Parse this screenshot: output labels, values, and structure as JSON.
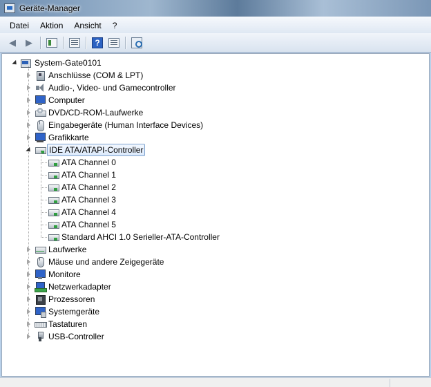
{
  "window": {
    "title": "Geräte-Manager"
  },
  "menu": [
    "Datei",
    "Aktion",
    "Ansicht",
    "?"
  ],
  "toolbar": {
    "buttons": [
      "back-icon",
      "forward-icon",
      "show-hide-console-tree-icon",
      "properties-icon",
      "help-icon",
      "action-pane-icon",
      "scan-hardware-icon"
    ]
  },
  "tree": {
    "root": "System-Gate0101",
    "categories": [
      {
        "label": "Anschlüsse (COM & LPT)",
        "icon": "port-icon"
      },
      {
        "label": "Audio-, Video- und Gamecontroller",
        "icon": "speaker-icon"
      },
      {
        "label": "Computer",
        "icon": "computer-icon"
      },
      {
        "label": "DVD/CD-ROM-Laufwerke",
        "icon": "dvd-drive-icon"
      },
      {
        "label": "Eingabegeräte (Human Interface Devices)",
        "icon": "hid-icon"
      },
      {
        "label": "Grafikkarte",
        "icon": "graphics-card-icon"
      },
      {
        "label": "IDE ATA/ATAPI-Controller",
        "icon": "ide-controller-icon",
        "expanded": true,
        "selected": true,
        "children": [
          "ATA Channel 0",
          "ATA Channel 1",
          "ATA Channel 2",
          "ATA Channel 3",
          "ATA Channel 4",
          "ATA Channel 5",
          "Standard AHCI 1.0 Serieller-ATA-Controller"
        ]
      },
      {
        "label": "Laufwerke",
        "icon": "disk-drive-icon"
      },
      {
        "label": "Mäuse und andere Zeigegeräte",
        "icon": "mouse-icon"
      },
      {
        "label": "Monitore",
        "icon": "monitor-icon"
      },
      {
        "label": "Netzwerkadapter",
        "icon": "network-adapter-icon"
      },
      {
        "label": "Prozessoren",
        "icon": "processor-icon"
      },
      {
        "label": "Systemgeräte",
        "icon": "system-devices-icon"
      },
      {
        "label": "Tastaturen",
        "icon": "keyboard-icon"
      },
      {
        "label": "USB-Controller",
        "icon": "usb-controller-icon"
      }
    ]
  }
}
